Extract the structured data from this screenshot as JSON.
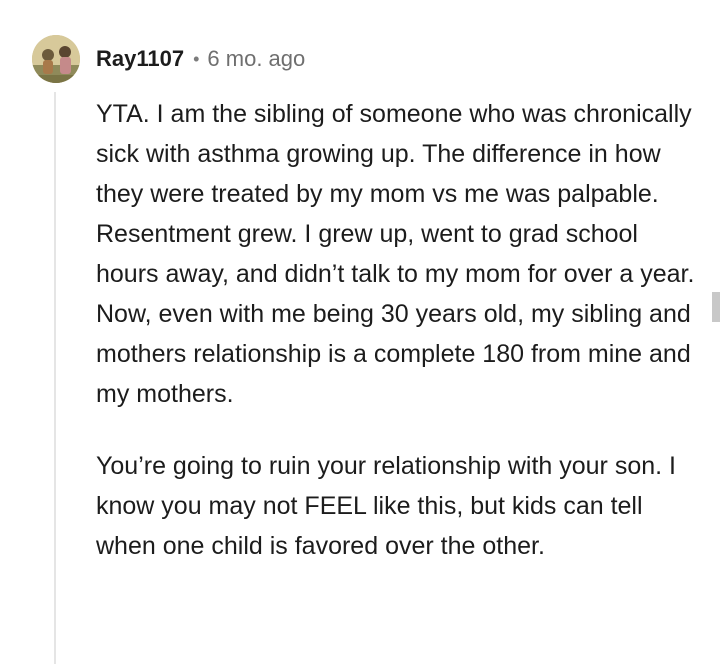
{
  "comment": {
    "username": "Ray1107",
    "separator": "•",
    "timestamp": "6 mo. ago",
    "paragraphs": [
      "YTA. I am the sibling of someone who was chronically sick with asthma growing up. The difference in how they were treated by my mom vs me was palpable. Resentment grew. I grew up, went to grad school hours away, and didn’t talk to my mom for over a year. Now, even with me being 30 years old, my sibling and mothers relationship is a complete 180 from mine and my mothers.",
      "You’re going to ruin your relationship with your son. I know you may not FEEL like this, but kids can tell when one child is favored over the other."
    ]
  },
  "colors": {
    "text": "#1c1c1c",
    "meta": "#6f6f6f",
    "thread_line": "#e5e5e5",
    "background": "#ffffff"
  },
  "icons": {
    "avatar": "user-avatar-icon"
  }
}
